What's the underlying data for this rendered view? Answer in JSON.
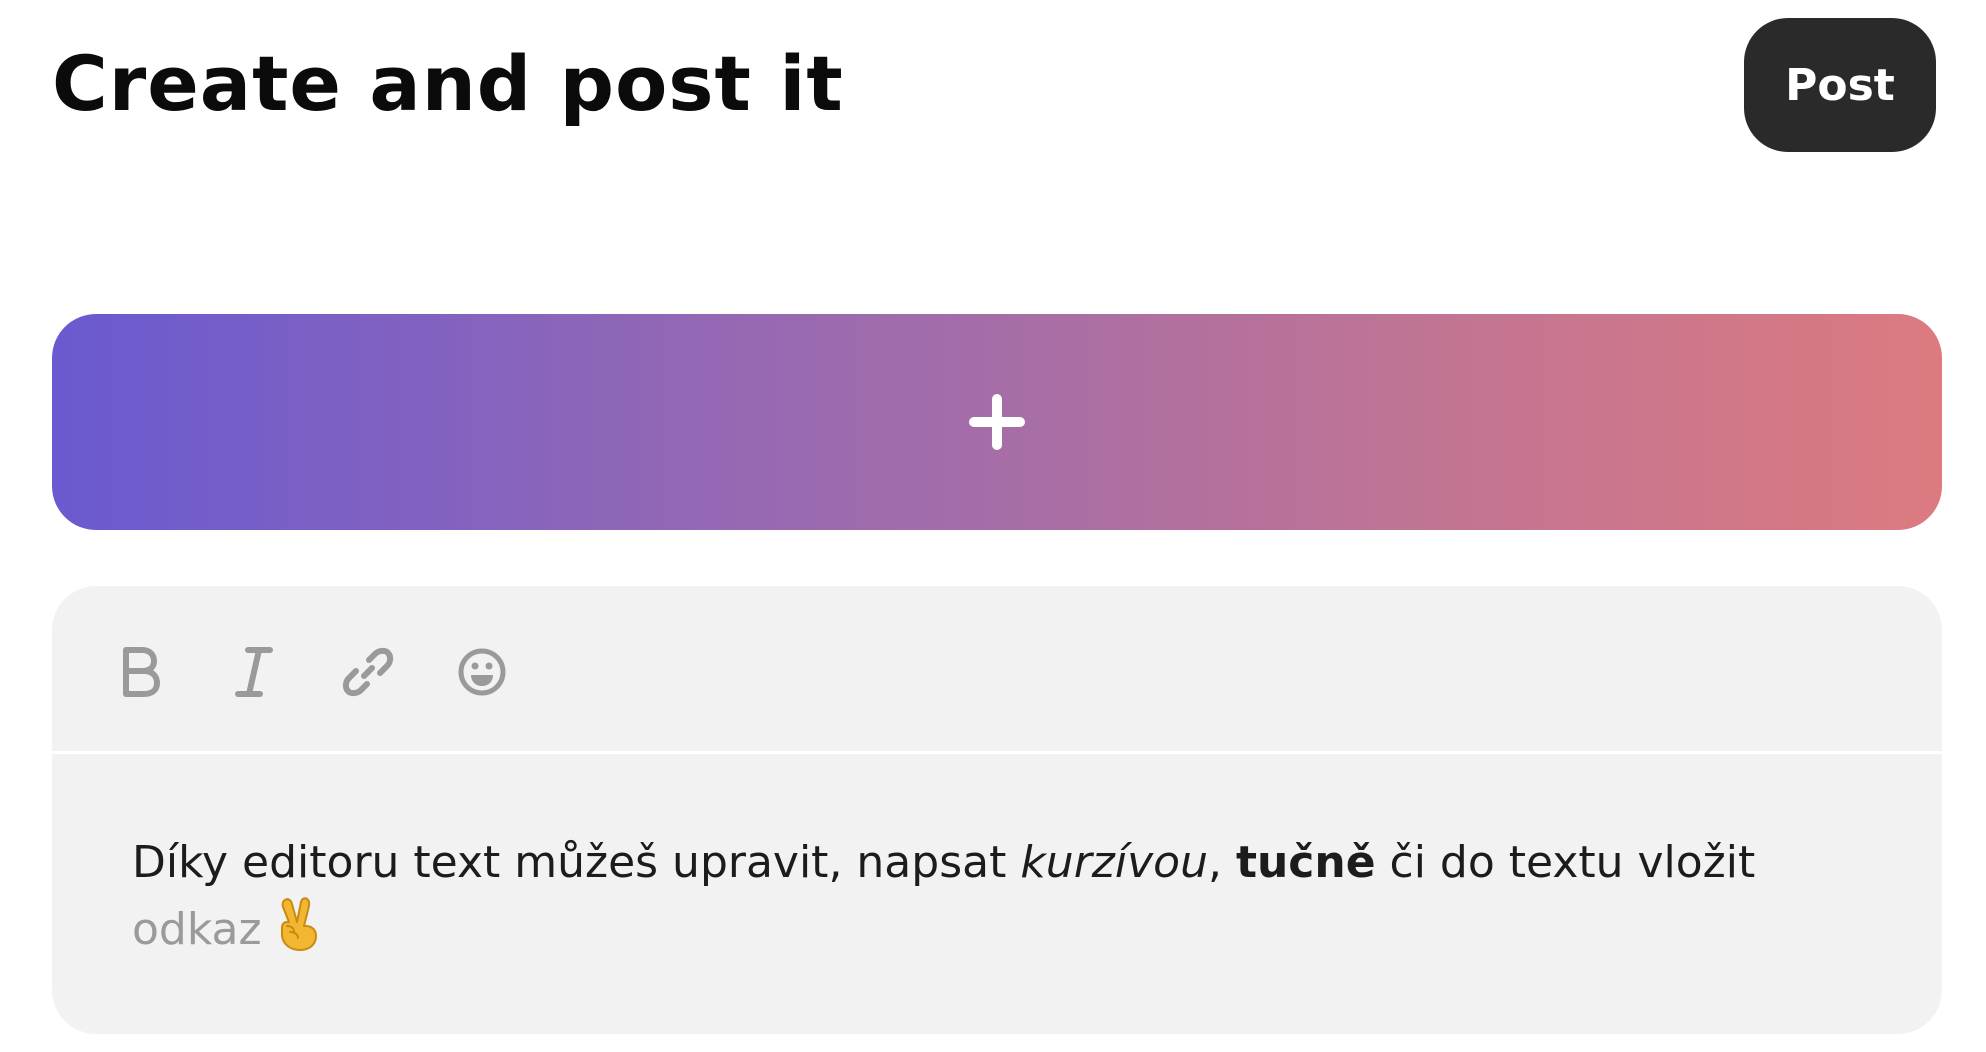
{
  "header": {
    "title": "Create and post it",
    "post_label": "Post"
  },
  "upload": {
    "icon": "plus-icon",
    "colors": {
      "start": "#6a5ad0",
      "end": "#dc7a80"
    }
  },
  "editor": {
    "toolbar": [
      {
        "name": "bold-icon",
        "symbol": "B"
      },
      {
        "name": "italic-icon",
        "symbol": "I"
      },
      {
        "name": "link-icon",
        "symbol": "chain"
      },
      {
        "name": "emoji-icon",
        "symbol": "smiley"
      }
    ],
    "content": {
      "text_1": "Díky editoru text můžeš upravit, napsat ",
      "italic": "kurzívou",
      "text_2": ", ",
      "bold": "tučně",
      "text_3": " či do textu vložit ",
      "link": "odkaz",
      "emoji": "victory-hand-icon"
    },
    "colors": {
      "background": "#f2f2f2",
      "icon": "#9a9a9a",
      "link": "#9a9a9a"
    }
  }
}
